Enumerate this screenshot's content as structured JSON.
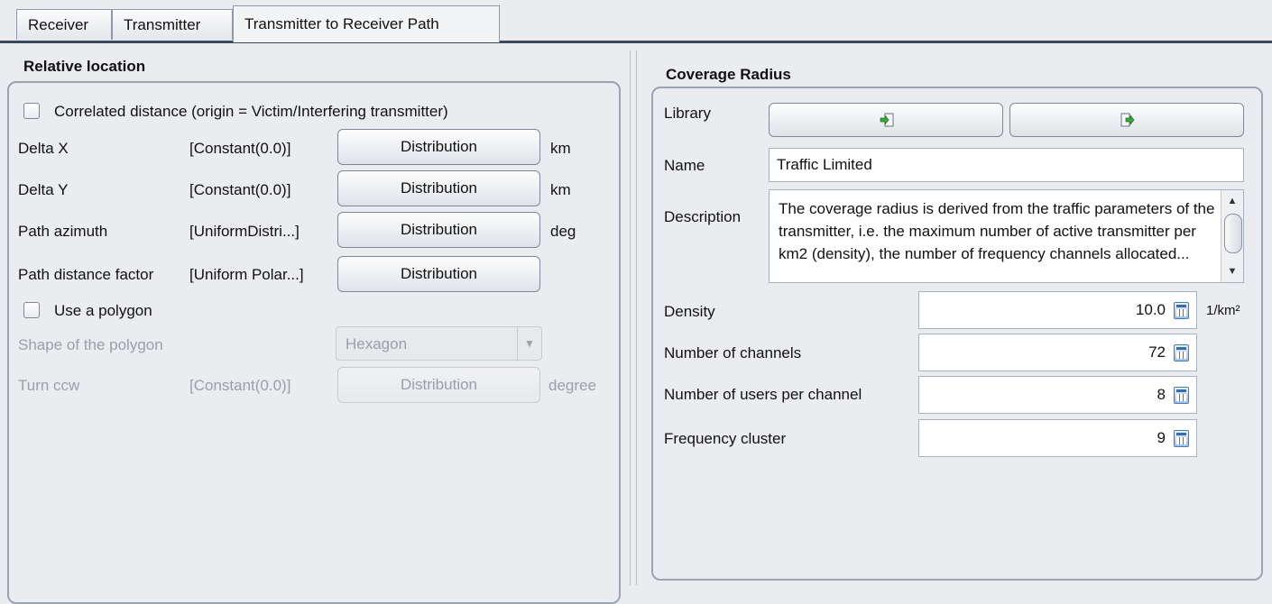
{
  "tabs": [
    {
      "label": "Receiver"
    },
    {
      "label": "Transmitter"
    },
    {
      "label": "Transmitter to Receiver Path"
    }
  ],
  "relative_location": {
    "title": "Relative location",
    "correlated_label": "Correlated distance (origin = Victim/Interfering transmitter)",
    "rows": [
      {
        "label": "Delta X",
        "value": "[Constant(0.0)]",
        "button": "Distribution",
        "unit": "km"
      },
      {
        "label": "Delta Y",
        "value": "[Constant(0.0)]",
        "button": "Distribution",
        "unit": "km"
      },
      {
        "label": "Path azimuth",
        "value": "[UniformDistri...]",
        "button": "Distribution",
        "unit": "deg"
      },
      {
        "label": "Path distance factor",
        "value": "[Uniform Polar...]",
        "button": "Distribution",
        "unit": ""
      }
    ],
    "polygon_label": "Use a polygon",
    "shape_label": "Shape of the polygon",
    "shape_value": "Hexagon",
    "turn_label": "Turn ccw",
    "turn_value": "[Constant(0.0)]",
    "turn_button": "Distribution",
    "turn_unit": "degree"
  },
  "coverage": {
    "title": "Coverage Radius",
    "library_label": "Library",
    "name_label": "Name",
    "name_value": "Traffic Limited",
    "description_label": "Description",
    "description_text": "The coverage radius is derived from the traffic parameters of the transmitter, i.e. the maximum number of active transmitter per km2 (density), the number of frequency channels allocated...",
    "fields": [
      {
        "label": "Density",
        "value": "10.0",
        "unit": "1/km²"
      },
      {
        "label": "Number of channels",
        "value": "72",
        "unit": ""
      },
      {
        "label": "Number of users per channel",
        "value": "8",
        "unit": ""
      },
      {
        "label": "Frequency cluster",
        "value": "9",
        "unit": ""
      }
    ]
  }
}
